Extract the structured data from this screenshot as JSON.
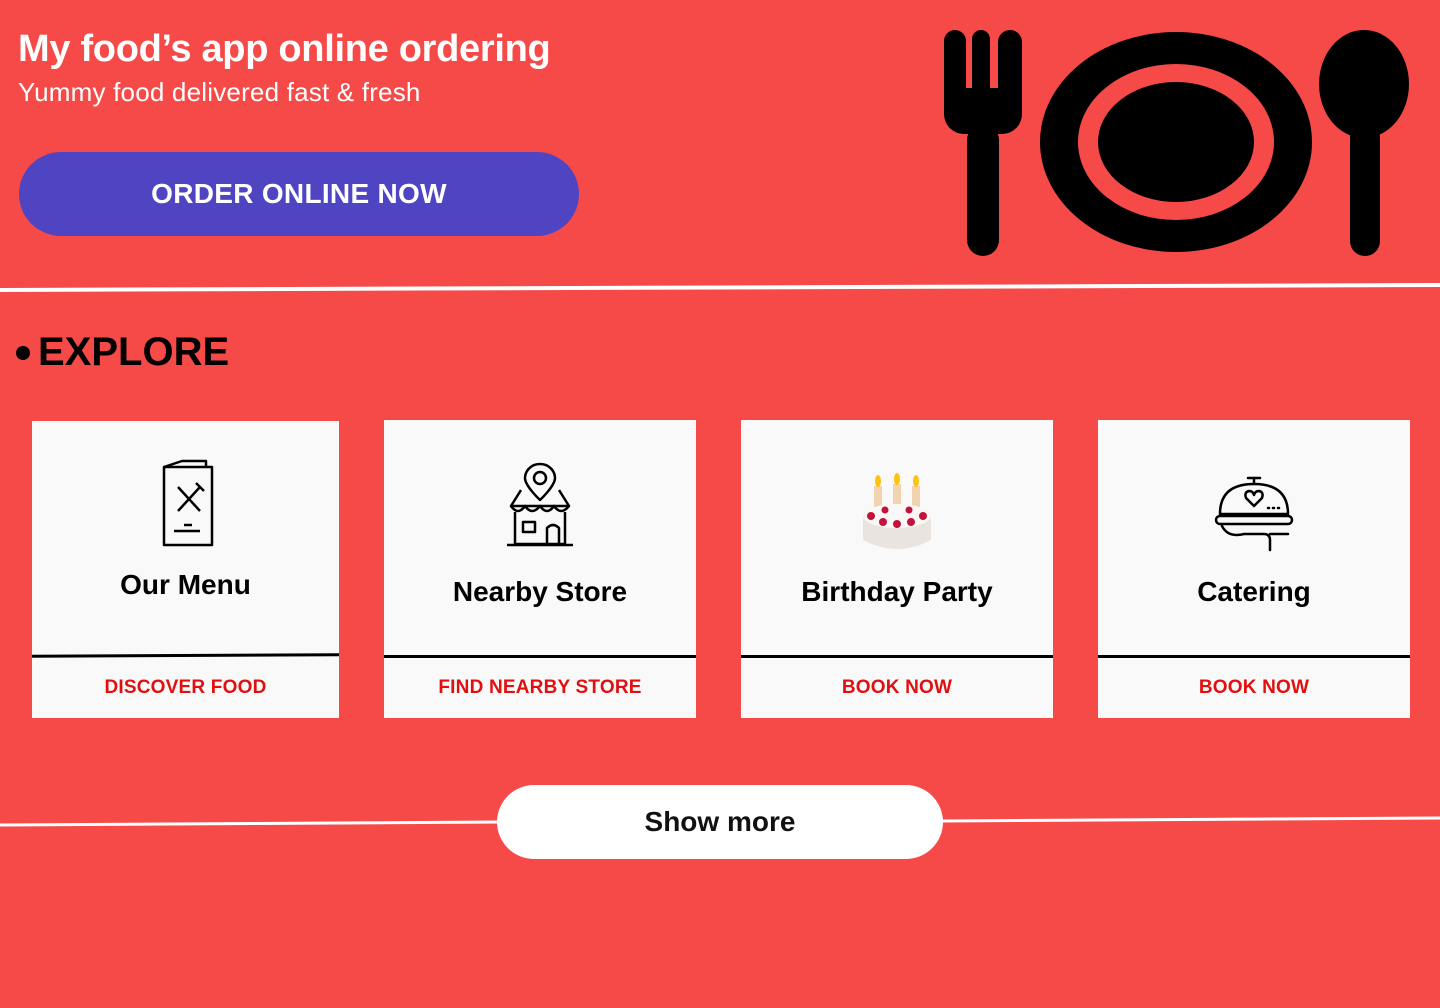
{
  "header": {
    "title": "My food’s app online ordering",
    "subtitle": "Yummy food delivered fast & fresh",
    "cta_label": "ORDER ONLINE NOW"
  },
  "explore": {
    "heading": "EXPLORE",
    "cards": [
      {
        "title": "Our Menu",
        "action": "DISCOVER FOOD",
        "icon": "menu-book-icon"
      },
      {
        "title": "Nearby Store",
        "action": "FIND NEARBY STORE",
        "icon": "store-location-icon"
      },
      {
        "title": "Birthday Party",
        "action": "BOOK NOW",
        "icon": "birthday-cake-icon"
      },
      {
        "title": "Catering",
        "action": "BOOK NOW",
        "icon": "catering-cloche-icon"
      }
    ],
    "show_more_label": "Show more"
  },
  "colors": {
    "background": "#f54a47",
    "primary_button": "#4f44c2",
    "action_text": "#e10f0f",
    "card_background": "#f9f9f9"
  }
}
